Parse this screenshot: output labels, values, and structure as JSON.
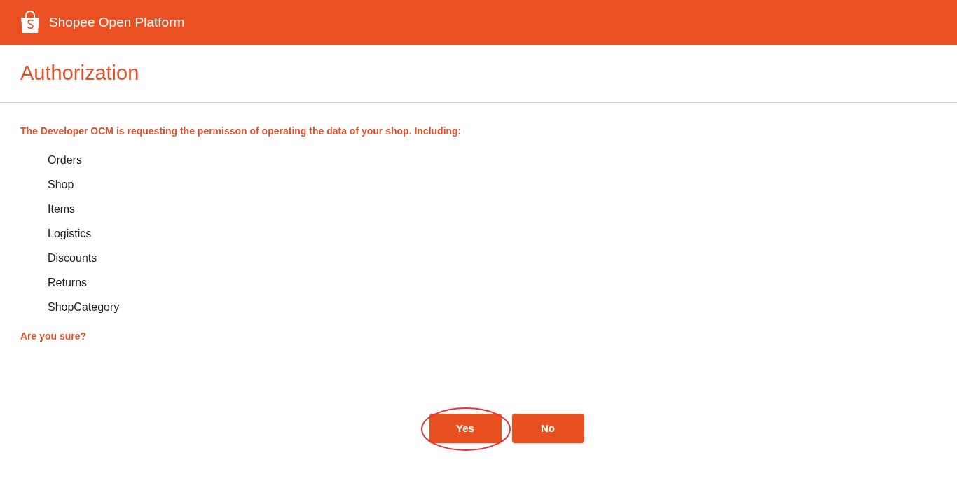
{
  "header": {
    "title": "Shopee Open Platform"
  },
  "page_title": "Authorization",
  "message": "The Developer OCM is requesting the permisson of operating the data of your shop. Including:",
  "permissions": [
    "Orders",
    "Shop",
    "Items",
    "Logistics",
    "Discounts",
    "Returns",
    "ShopCategory"
  ],
  "question": "Are you sure?",
  "buttons": [
    {
      "label": "Yes",
      "highlighted": true
    },
    {
      "label": "No",
      "highlighted": false
    }
  ]
}
